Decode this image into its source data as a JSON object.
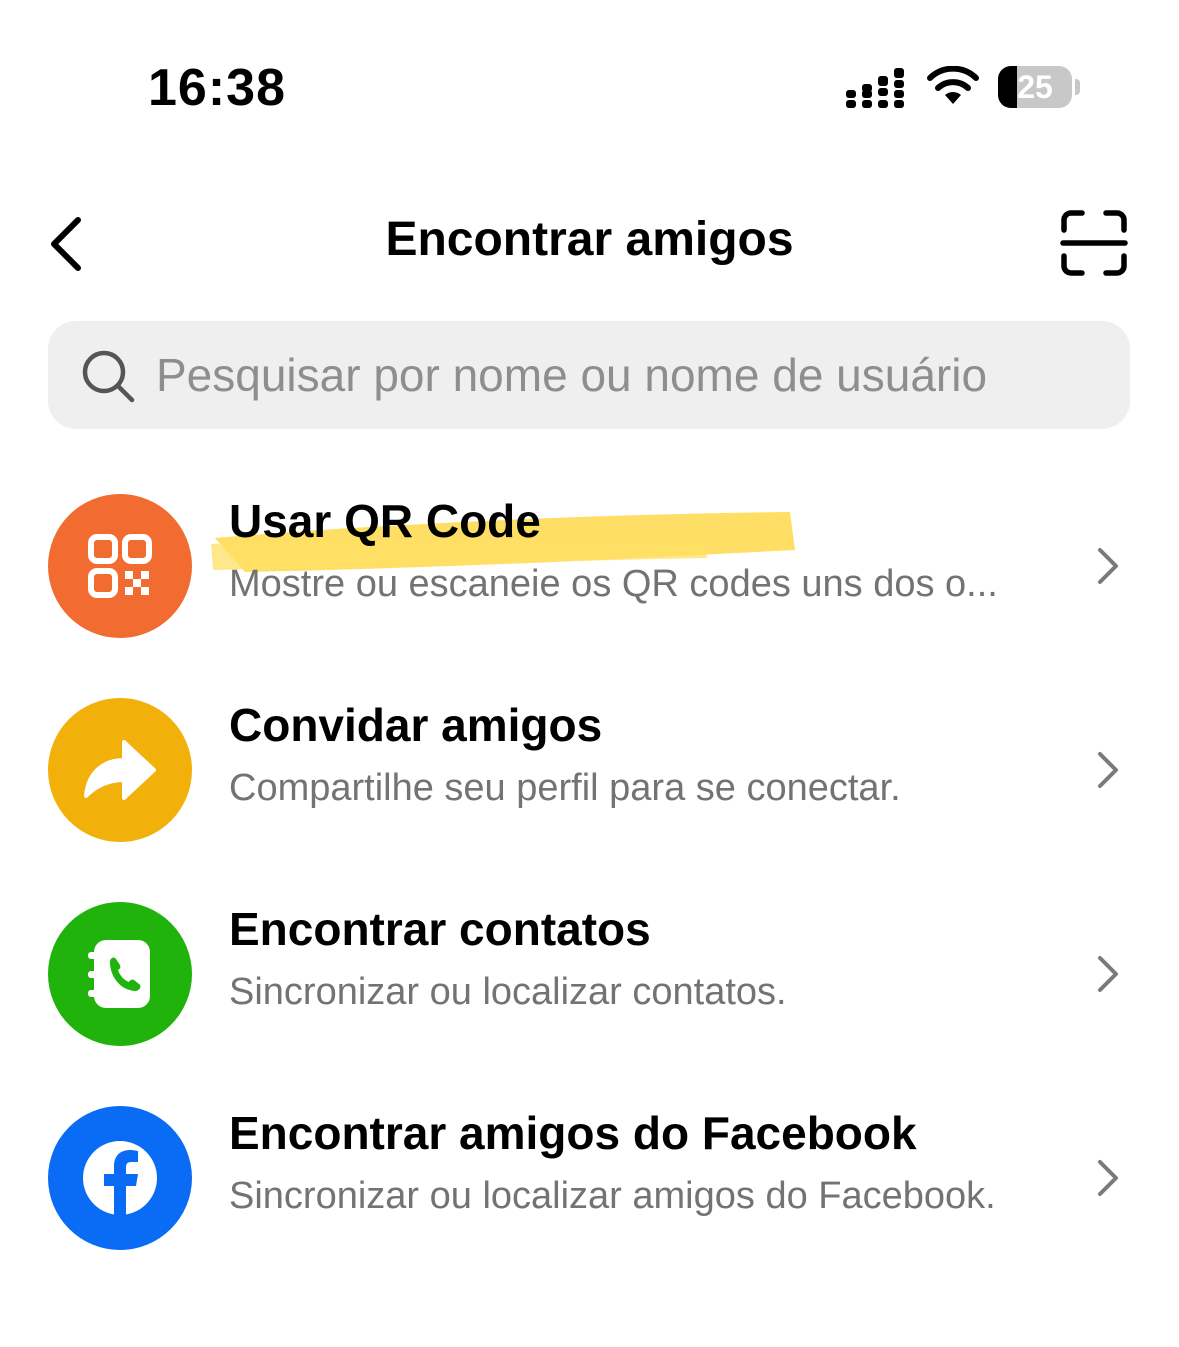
{
  "status_bar": {
    "time": "16:38",
    "battery_level": "25",
    "battery_fraction": 0.25
  },
  "header": {
    "title": "Encontrar amigos",
    "back_icon": "chevron-left-icon",
    "scan_icon": "scan-frame-icon"
  },
  "search": {
    "placeholder": "Pesquisar por nome ou nome de usuário",
    "value": ""
  },
  "items": [
    {
      "title": "Usar QR Code",
      "subtitle": "Mostre ou escaneie os QR codes uns dos o...",
      "icon": "qr-code-icon",
      "color": "#f26b30"
    },
    {
      "title": "Convidar amigos",
      "subtitle": "Compartilhe seu perfil para se conectar.",
      "icon": "share-arrow-icon",
      "color": "#f2b00a"
    },
    {
      "title": "Encontrar contatos",
      "subtitle": "Sincronizar ou localizar contatos.",
      "icon": "contacts-book-icon",
      "color": "#1fb30c"
    },
    {
      "title": "Encontrar amigos do Facebook",
      "subtitle": "Sincronizar ou localizar amigos do Facebook.",
      "icon": "facebook-icon",
      "color": "#0a6cf5"
    }
  ],
  "colors": {
    "highlight": "#ffd84a",
    "search_background": "#efefef",
    "secondary_text": "#737373",
    "chevron": "#7a7a7a"
  }
}
